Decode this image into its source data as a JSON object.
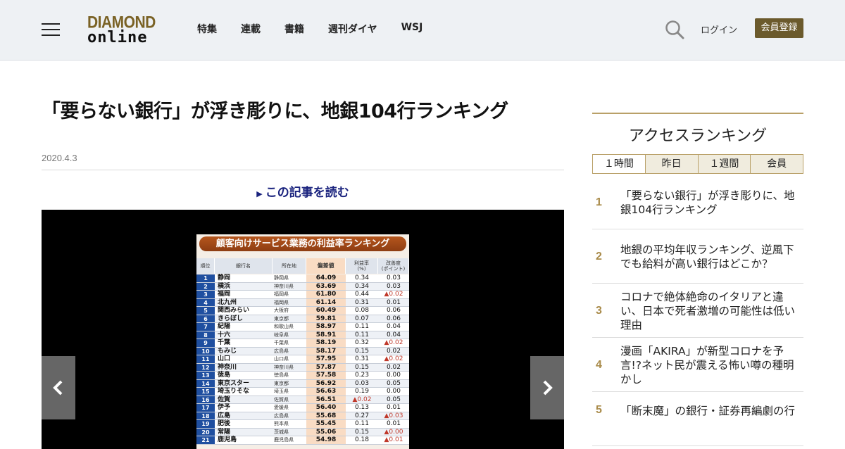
{
  "header": {
    "logo_top": "DIAMOND",
    "logo_bottom": "online",
    "nav": [
      "特集",
      "連載",
      "書籍",
      "週刊ダイヤ",
      "WSJ"
    ],
    "login": "ログイン",
    "register": "会員登録",
    "brand_color": "#6b5a2c"
  },
  "article": {
    "title": "「要らない銀行」が浮き彫りに、地銀104行ランキング",
    "date": "2020.4.3",
    "read_link": "この記事を読む",
    "gallery_image": {
      "title": "顧客向けサービス業務の利益率ランキング",
      "headers": [
        "順位",
        "銀行名",
        "所在地",
        "偏差値",
        "利益率\n(%)",
        "改善度\n(ポイント)"
      ],
      "rows": [
        [
          "1",
          "静岡",
          "静岡県",
          "64.09",
          "0.34",
          "0.03"
        ],
        [
          "2",
          "横浜",
          "神奈川県",
          "63.69",
          "0.34",
          "0.03"
        ],
        [
          "3",
          "福岡",
          "福岡県",
          "61.80",
          "0.44",
          "▲0.02"
        ],
        [
          "4",
          "北九州",
          "福岡県",
          "61.14",
          "0.31",
          "0.01"
        ],
        [
          "5",
          "関西みらい",
          "大阪府",
          "60.49",
          "0.08",
          "0.06"
        ],
        [
          "6",
          "きらぼし",
          "東京都",
          "59.81",
          "0.07",
          "0.06"
        ],
        [
          "7",
          "紀陽",
          "和歌山県",
          "58.97",
          "0.11",
          "0.04"
        ],
        [
          "8",
          "十六",
          "岐阜県",
          "58.91",
          "0.11",
          "0.04"
        ],
        [
          "9",
          "千葉",
          "千葉県",
          "58.19",
          "0.32",
          "▲0.02"
        ],
        [
          "10",
          "もみじ",
          "広島県",
          "58.17",
          "0.15",
          "0.02"
        ],
        [
          "11",
          "山口",
          "山口県",
          "57.95",
          "0.31",
          "▲0.02"
        ],
        [
          "12",
          "神奈川",
          "神奈川県",
          "57.87",
          "0.15",
          "0.02"
        ],
        [
          "13",
          "徳島",
          "徳島県",
          "57.58",
          "0.23",
          "0.00"
        ],
        [
          "14",
          "東京スター",
          "東京都",
          "56.92",
          "0.03",
          "0.05"
        ],
        [
          "15",
          "埼玉りそな",
          "埼玉県",
          "56.63",
          "0.19",
          "0.00"
        ],
        [
          "16",
          "佐賀",
          "佐賀県",
          "56.51",
          "▲0.02",
          "0.05"
        ],
        [
          "17",
          "伊予",
          "愛媛県",
          "56.40",
          "0.13",
          "0.01"
        ],
        [
          "18",
          "広島",
          "広島県",
          "55.68",
          "0.27",
          "▲0.03"
        ],
        [
          "19",
          "肥後",
          "熊本県",
          "55.45",
          "0.11",
          "0.01"
        ],
        [
          "20",
          "常陽",
          "茨城県",
          "55.06",
          "0.15",
          "▲0.00"
        ],
        [
          "21",
          "鹿児島",
          "鹿児島県",
          "54.98",
          "0.18",
          "▲0.01"
        ]
      ]
    }
  },
  "sidebar": {
    "title": "アクセスランキング",
    "tabs": [
      "１時間",
      "昨日",
      "１週間",
      "会員"
    ],
    "items": [
      {
        "rank": "1",
        "text": "「要らない銀行」が浮き彫りに、地銀104行ランキング"
      },
      {
        "rank": "2",
        "text": "地銀の平均年収ランキング、逆風下でも給料が高い銀行はどこか？"
      },
      {
        "rank": "3",
        "text": "コロナで絶体絶命のイタリアと違い、日本で死者激増の可能性は低い理由"
      },
      {
        "rank": "4",
        "text": "漫画「AKIRA」が新型コロナを予言!?ネット民が震える怖い噂の種明かし"
      },
      {
        "rank": "5",
        "text": "「断末魔」の銀行・証券再編劇の行"
      }
    ]
  }
}
